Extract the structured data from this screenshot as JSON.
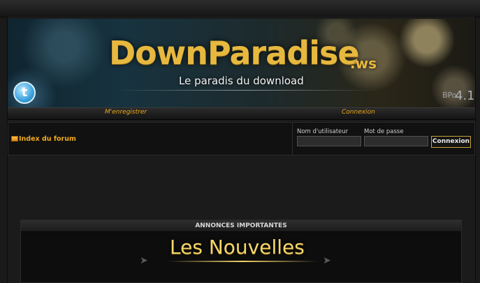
{
  "banner": {
    "site_title": "DownParadise",
    "site_suffix": ".ws",
    "tagline": "Le paradis du download",
    "version_small": "BPo",
    "version": "4.1"
  },
  "nav": {
    "register": "M'enregistrer",
    "login": "Connexion"
  },
  "breadcrumb": {
    "index": "Index du forum"
  },
  "login_form": {
    "username_label": "Nom d'utilisateur",
    "password_label": "Mot de passe",
    "username_value": "",
    "password_value": "",
    "submit": "Connexion"
  },
  "announcements": {
    "heading": "ANNONCES IMPORTANTES",
    "banner_text": "Les Nouvelles"
  },
  "colors": {
    "accent": "#e9a81d",
    "gold": "#e7b83f",
    "background": "#1b1b1b"
  }
}
